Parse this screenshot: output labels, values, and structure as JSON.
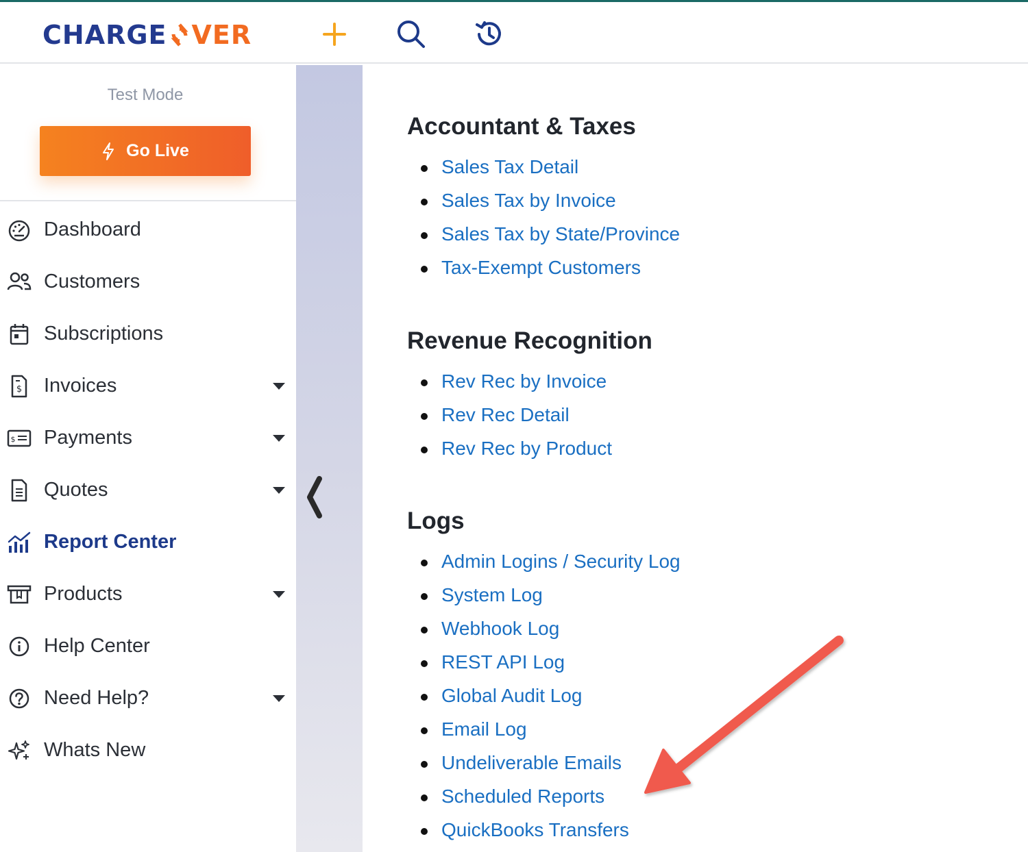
{
  "header": {
    "logo_left": "CHARGE",
    "logo_right": "VER",
    "add_icon": "plus-icon",
    "search_icon": "search-icon",
    "history_icon": "history-icon",
    "colors": {
      "brand_blue": "#233a8f",
      "brand_orange": "#f26b21",
      "plus": "#f5a51e"
    }
  },
  "sidebar": {
    "mode_label": "Test Mode",
    "go_live_label": "Go Live",
    "items": [
      {
        "label": "Dashboard",
        "icon": "gauge-icon",
        "has_caret": false,
        "active": false
      },
      {
        "label": "Customers",
        "icon": "users-icon",
        "has_caret": false,
        "active": false
      },
      {
        "label": "Subscriptions",
        "icon": "calendar-icon",
        "has_caret": false,
        "active": false
      },
      {
        "label": "Invoices",
        "icon": "invoice-icon",
        "has_caret": true,
        "active": false
      },
      {
        "label": "Payments",
        "icon": "payment-card-icon",
        "has_caret": true,
        "active": false
      },
      {
        "label": "Quotes",
        "icon": "document-icon",
        "has_caret": true,
        "active": false
      },
      {
        "label": "Report Center",
        "icon": "chart-icon",
        "has_caret": false,
        "active": true
      },
      {
        "label": "Products",
        "icon": "box-icon",
        "has_caret": true,
        "active": false
      },
      {
        "label": "Help Center",
        "icon": "info-icon",
        "has_caret": false,
        "active": false
      },
      {
        "label": "Need Help?",
        "icon": "question-icon",
        "has_caret": true,
        "active": false
      },
      {
        "label": "Whats New",
        "icon": "sparkle-icon",
        "has_caret": false,
        "active": false
      }
    ]
  },
  "content": {
    "sections": [
      {
        "title": "Accountant & Taxes",
        "links": [
          "Sales Tax Detail",
          "Sales Tax by Invoice",
          "Sales Tax by State/Province",
          "Tax-Exempt Customers"
        ]
      },
      {
        "title": "Revenue Recognition",
        "links": [
          "Rev Rec by Invoice",
          "Rev Rec Detail",
          "Rev Rec by Product"
        ]
      },
      {
        "title": "Logs",
        "links": [
          "Admin Logins / Security Log",
          "System Log",
          "Webhook Log",
          "REST API Log",
          "Global Audit Log",
          "Email Log",
          "Undeliverable Emails",
          "Scheduled Reports",
          "QuickBooks Transfers"
        ]
      }
    ],
    "link_color": "#1a6fc2",
    "annotation_color": "#f05a4e"
  }
}
